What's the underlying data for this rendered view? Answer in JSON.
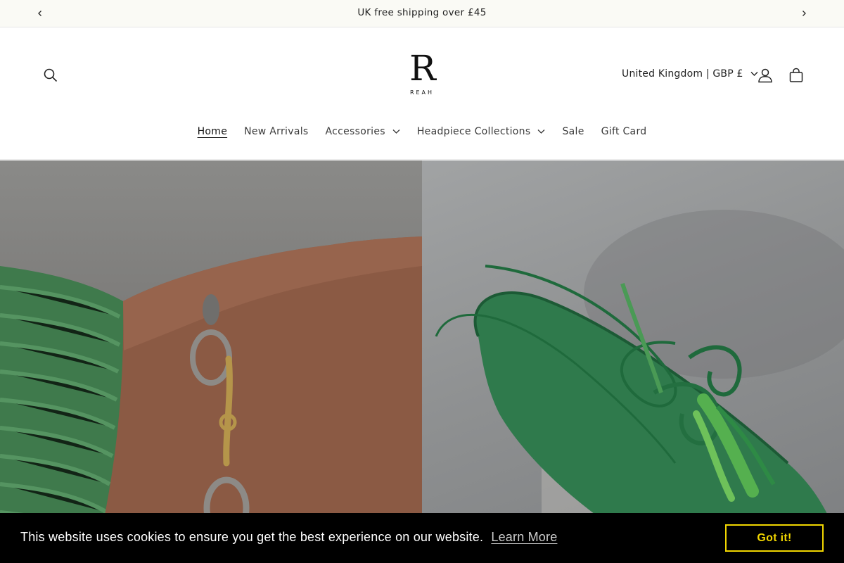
{
  "announcement": {
    "text": "UK free shipping over £45",
    "prev_icon": "chevron-left-icon",
    "next_icon": "chevron-right-icon"
  },
  "header": {
    "logo_mark": "R",
    "logo_word": "REAH",
    "locale_label": "United Kingdom | GBP £",
    "icons": [
      "search-icon",
      "account-icon",
      "cart-icon"
    ]
  },
  "nav": {
    "items": [
      {
        "label": "Home",
        "active": true,
        "has_dropdown": false
      },
      {
        "label": "New Arrivals",
        "active": false,
        "has_dropdown": false
      },
      {
        "label": "Accessories",
        "active": false,
        "has_dropdown": true
      },
      {
        "label": "Headpiece Collections",
        "active": false,
        "has_dropdown": true
      },
      {
        "label": "Sale",
        "active": false,
        "has_dropdown": false
      },
      {
        "label": "Gift Card",
        "active": false,
        "has_dropdown": false
      }
    ]
  },
  "cookie": {
    "message": "This website uses cookies to ensure you get the best experience on our website.",
    "learn_more": "Learn More",
    "accept": "Got it!"
  },
  "colors": {
    "accent_yellow": "#f1d600",
    "announcement_bg": "#fafaf5",
    "cookie_bg": "#000000"
  }
}
